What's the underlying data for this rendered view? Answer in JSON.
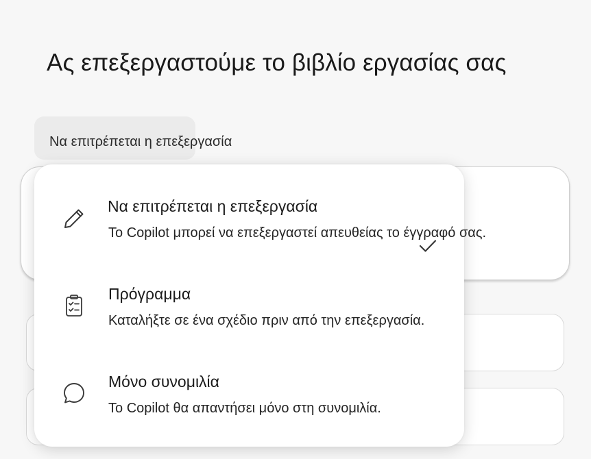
{
  "header": {
    "title": "Ας επεξεργαστούμε το βιβλίο εργασίας σας"
  },
  "mode_select": {
    "selected_label": "Να επιτρέπεται η επεξεργασία"
  },
  "menu": {
    "items": [
      {
        "title": "Να επιτρέπεται η επεξεργασία",
        "description": "Το Copilot μπορεί να επεξεργαστεί απευθείας το έγγραφό σας.",
        "icon": "pencil-icon",
        "selected": true
      },
      {
        "title": "Πρόγραμμα",
        "description": "Καταλήξτε σε ένα σχέδιο πριν από την επεξεργασία.",
        "icon": "clipboard-checklist-icon",
        "selected": false
      },
      {
        "title": "Μόνο συνομιλία",
        "description": "Το Copilot θα απαντήσει μόνο στη συνομιλία.",
        "icon": "chat-bubble-icon",
        "selected": false
      }
    ]
  },
  "colors": {
    "background": "#f7f7f7",
    "select_background": "#ebebeb",
    "menu_background": "#ffffff",
    "text": "#1b1b1b"
  }
}
